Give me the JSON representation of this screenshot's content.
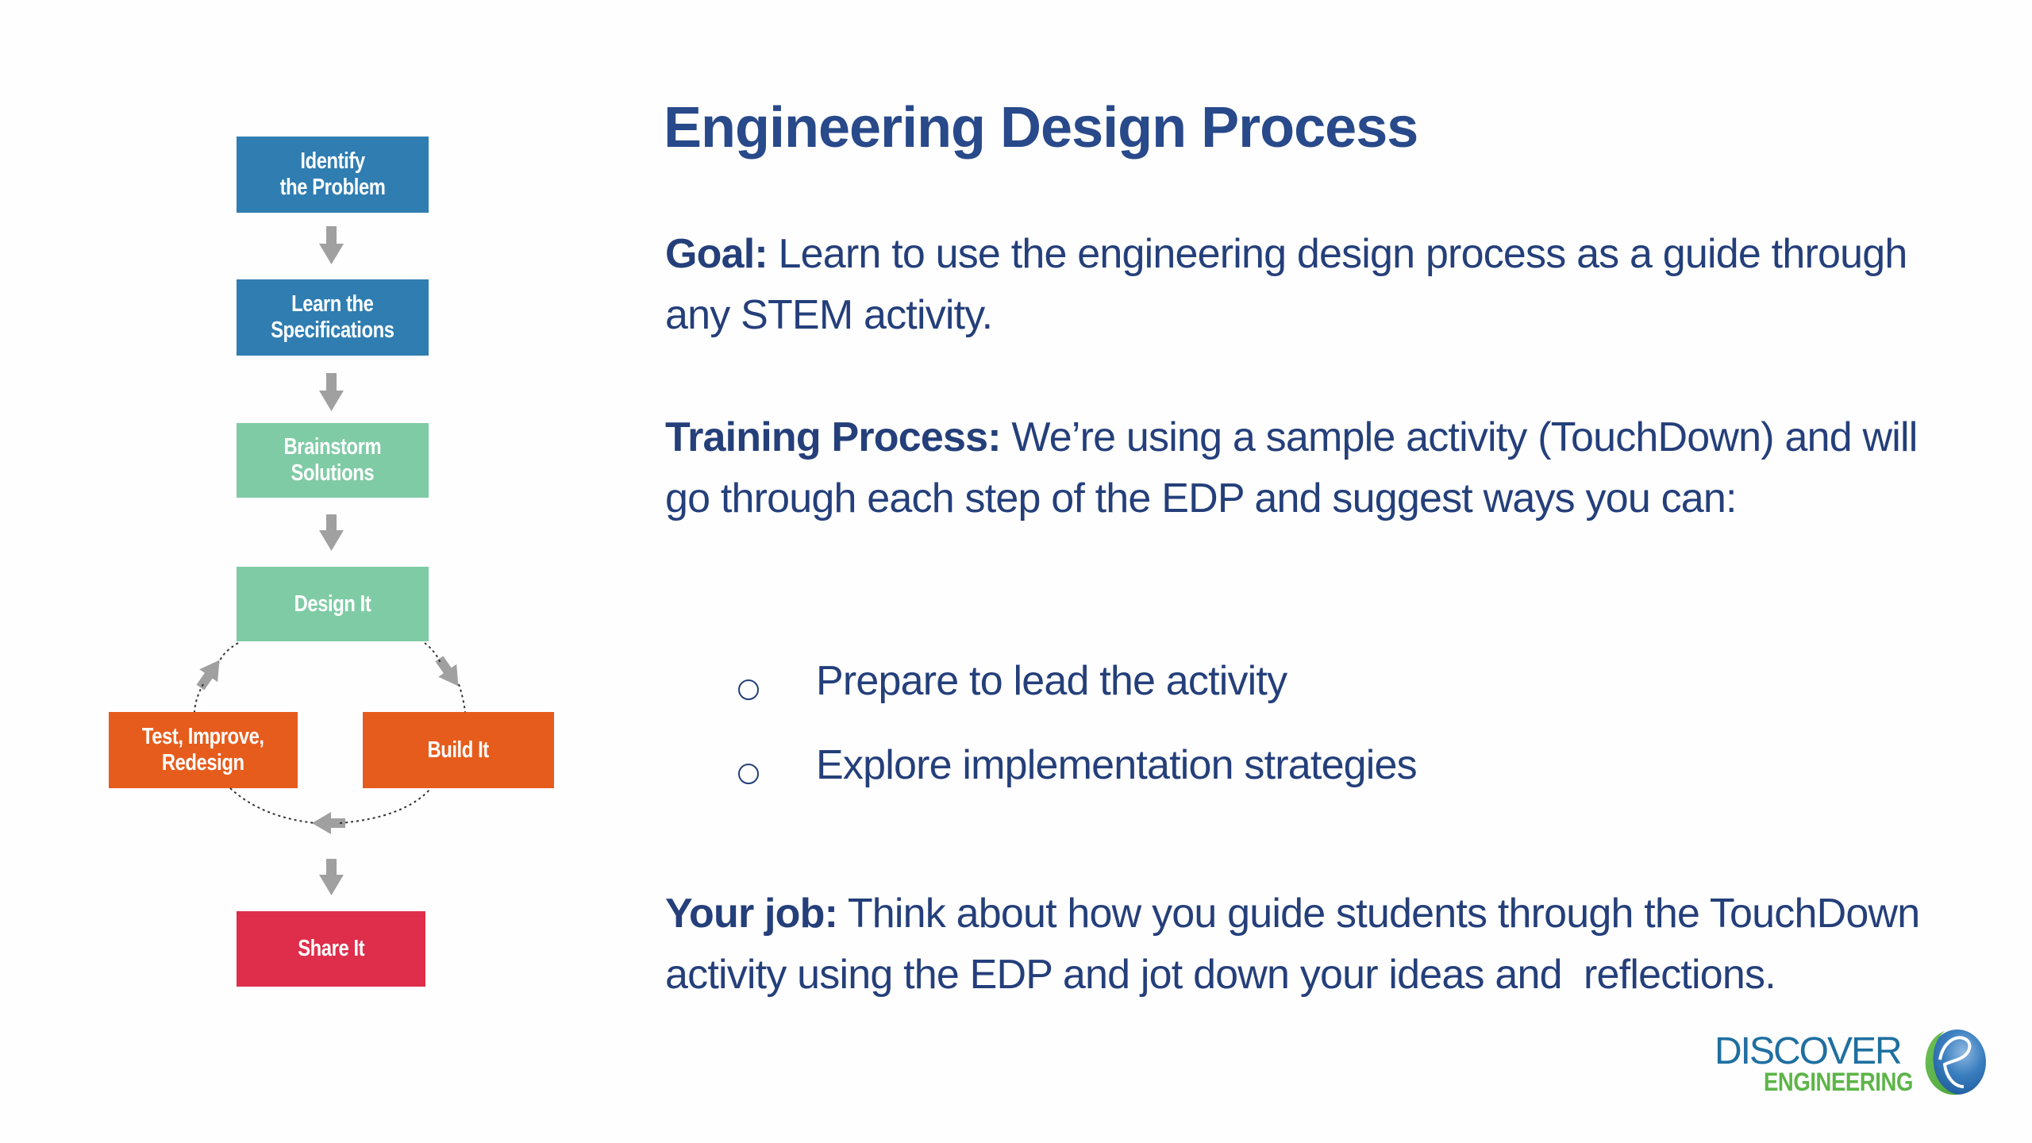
{
  "slide": {
    "title": "Engineering Design Process",
    "goal": {
      "label": "Goal:",
      "text": " Learn to use the engineering design process as a guide through any STEM activity."
    },
    "training": {
      "label": "Training Process:",
      "text": " We’re using a sample activity (TouchDown) and will go through each step of the EDP and suggest ways you can:"
    },
    "bullets": [
      {
        "marker": "circle-bullet-icon",
        "text": "Prepare to lead the activity"
      },
      {
        "marker": "circle-bullet-icon",
        "text": "Explore implementation strategies"
      }
    ],
    "your_job": {
      "label": "Your job:",
      "text": " Think about how you guide students through the TouchDown activity using the EDP and jot down your ideas and  reflections."
    }
  },
  "flowchart": {
    "steps": [
      {
        "id": "identify",
        "label": "Identify\nthe Problem",
        "color": "#2f7db1"
      },
      {
        "id": "learn",
        "label": "Learn the\nSpecifications",
        "color": "#2f7db1"
      },
      {
        "id": "brainstorm",
        "label": "Brainstorm\nSolutions",
        "color": "#7fcba5"
      },
      {
        "id": "design",
        "label": "Design It",
        "color": "#7fcba5"
      },
      {
        "id": "build",
        "label": "Build It",
        "color": "#e65c1c"
      },
      {
        "id": "test",
        "label": "Test, Improve,\nRedesign",
        "color": "#e65c1c"
      },
      {
        "id": "share",
        "label": "Share It",
        "color": "#de2e4b"
      }
    ],
    "edges": [
      {
        "from": "identify",
        "to": "learn"
      },
      {
        "from": "learn",
        "to": "brainstorm"
      },
      {
        "from": "brainstorm",
        "to": "design"
      },
      {
        "from": "design",
        "to": "build"
      },
      {
        "from": "build",
        "to": "test"
      },
      {
        "from": "test",
        "to": "design"
      },
      {
        "from": "test",
        "to": "share"
      }
    ],
    "arrow_color": "#a0a0a0",
    "loop_line_color": "#333333"
  },
  "logo": {
    "line1": "DISCOVER",
    "line2": "ENGINEERING",
    "icon": "discover-e-globe-icon",
    "colors": {
      "blue": "#1f6fa0",
      "green": "#5db548"
    }
  }
}
